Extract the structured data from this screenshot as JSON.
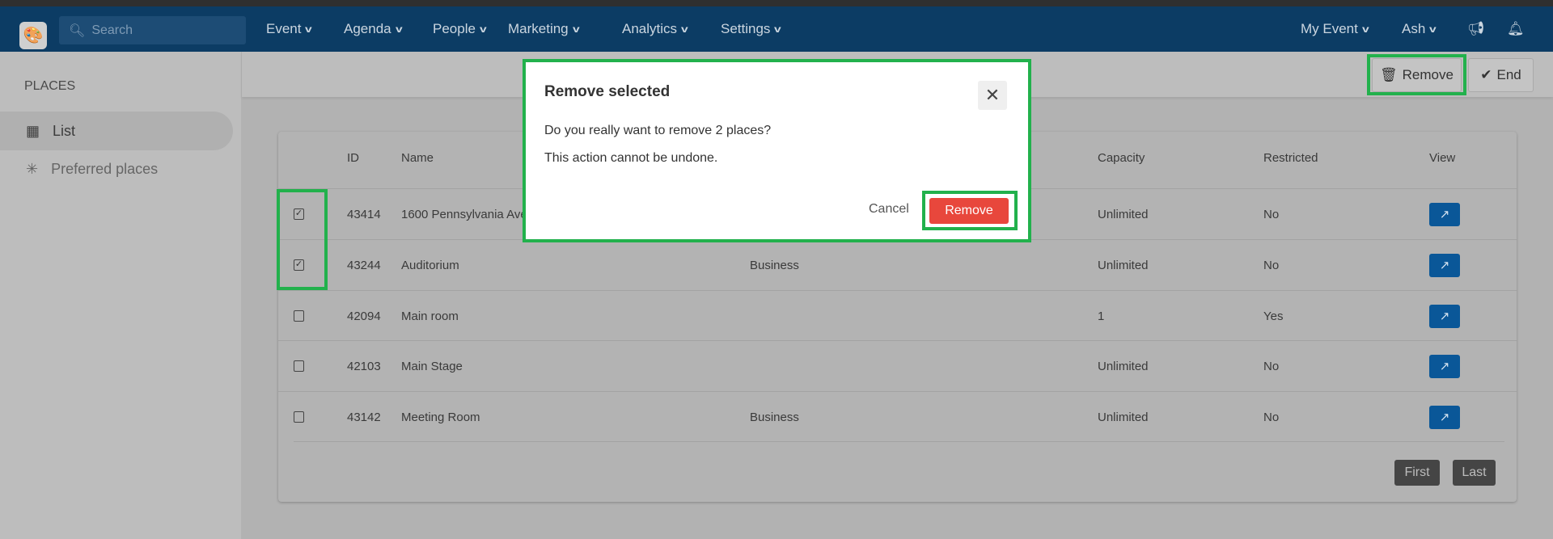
{
  "nav": {
    "search_placeholder": "Search",
    "items": [
      "Event",
      "Agenda",
      "People",
      "Marketing",
      "Analytics",
      "Settings"
    ],
    "right": [
      "My Event",
      "Ash"
    ],
    "color": "#0c3c64"
  },
  "sidebar": {
    "section": "PLACES",
    "items": [
      {
        "label": "List",
        "icon": "table-icon"
      },
      {
        "label": "Preferred places",
        "icon": "asterisk-icon"
      }
    ]
  },
  "toolbar": {
    "remove_label": "Remove",
    "end_label": "End"
  },
  "table": {
    "headers": {
      "id": "ID",
      "name": "Name",
      "capacity": "Capacity",
      "restricted": "Restricted",
      "view": "View"
    },
    "rows": [
      {
        "checked": true,
        "id": "43414",
        "name": "1600 Pennsylvania Ave",
        "type": "",
        "capacity": "Unlimited",
        "restricted": "No"
      },
      {
        "checked": true,
        "id": "43244",
        "name": "Auditorium",
        "type": "Business",
        "capacity": "Unlimited",
        "restricted": "No"
      },
      {
        "checked": false,
        "id": "42094",
        "name": "Main room",
        "type": "",
        "capacity": "1",
        "restricted": "Yes"
      },
      {
        "checked": false,
        "id": "42103",
        "name": "Main Stage",
        "type": "",
        "capacity": "Unlimited",
        "restricted": "No"
      },
      {
        "checked": false,
        "id": "43142",
        "name": "Meeting Room",
        "type": "Business",
        "capacity": "Unlimited",
        "restricted": "No"
      }
    ]
  },
  "pagination": {
    "first": "First",
    "last": "Last"
  },
  "dialog": {
    "title": "Remove selected",
    "message": "Do you really want to remove 2 places?",
    "warning": "This action cannot be undone.",
    "cancel": "Cancel",
    "confirm": "Remove",
    "confirm_color": "#e8473c",
    "highlight_color": "#22b14c"
  }
}
